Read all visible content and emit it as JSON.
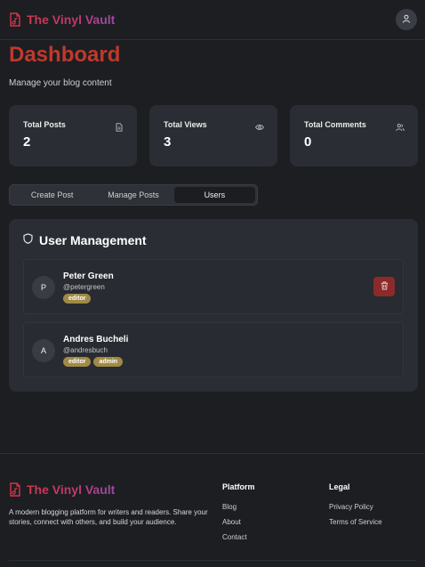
{
  "header": {
    "brand": "The Vinyl Vault",
    "brand_icon": "music-file-icon",
    "account_icon": "user-icon"
  },
  "page": {
    "title": "Dashboard",
    "subtitle": "Manage your blog content"
  },
  "stats": [
    {
      "label": "Total Posts",
      "value": "2",
      "icon": "document-icon"
    },
    {
      "label": "Total Views",
      "value": "3",
      "icon": "eye-icon"
    },
    {
      "label": "Total Comments",
      "value": "0",
      "icon": "users-icon"
    }
  ],
  "tabs": [
    {
      "label": "Create Post",
      "active": false
    },
    {
      "label": "Manage Posts",
      "active": false
    },
    {
      "label": "Users",
      "active": true
    }
  ],
  "user_management": {
    "title": "User Management",
    "icon": "shield-icon",
    "users": [
      {
        "initial": "P",
        "name": "Peter Green",
        "handle": "@petergreen",
        "roles": [
          "editor"
        ],
        "deletable": true
      },
      {
        "initial": "A",
        "name": "Andres Bucheli",
        "handle": "@andresbuch",
        "roles": [
          "editor",
          "admin"
        ],
        "deletable": false
      }
    ]
  },
  "footer": {
    "brand": "The Vinyl Vault",
    "description": "A modern blogging platform for writers and readers. Share your stories, connect with others, and build your audience.",
    "platform": {
      "title": "Platform",
      "links": [
        "Blog",
        "About",
        "Contact"
      ]
    },
    "legal": {
      "title": "Legal",
      "links": [
        "Privacy Policy",
        "Terms of Service"
      ]
    }
  },
  "colors": {
    "brand_red": "#c0392b",
    "badge": "#a08a45",
    "delete": "#8b2a2a",
    "background": "#1c1e22",
    "card": "#2a2d33"
  }
}
